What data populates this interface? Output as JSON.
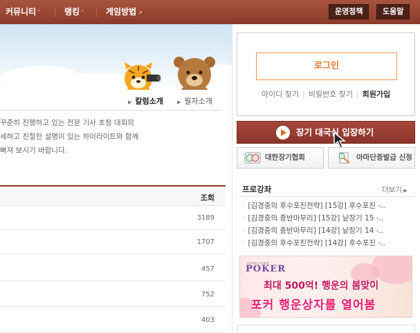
{
  "nav": {
    "items": [
      {
        "label": "커뮤니티",
        "caret": "˅"
      },
      {
        "label": "랭킹",
        "caret": "˅"
      },
      {
        "label": "게임방법",
        "caret": "↗"
      }
    ],
    "policy_button": "운영정책",
    "help_button": "도움말"
  },
  "subtabs": {
    "column_intro": "칼럼소개",
    "writer_intro": "필자소개"
  },
  "intro_lines": [
    "꾸준히 진행하고 있는 전문 기사 초청 대회의",
    "세하고 친절한 설명이 있는 하이라이트와 함께",
    "빠져 보시기 바랍니다."
  ],
  "table": {
    "views_header": "조회",
    "rows": [
      {
        "views": "3189"
      },
      {
        "views": "1707"
      },
      {
        "views": "457"
      },
      {
        "views": "752"
      },
      {
        "views": "403"
      }
    ]
  },
  "login": {
    "button": "로그인",
    "find_id": "아이디 찾기",
    "find_pw": "비밀번호 찾기",
    "signup": "회원가입"
  },
  "enter_button": "장기 대국실 입장하기",
  "partners": {
    "association": "대한장기협회",
    "amateur": "아마단증발급 신청"
  },
  "pro_lessons": {
    "title": "프로강좌",
    "more": "더보기",
    "items": [
      "[김경중의 후수포진전략] [15강] 후수포진 -..",
      "[김경중의 종반마무리] [15강] 낱장기 15 -..",
      "[김경중의 종반마무리] [14강] 낱장기 14 -..",
      "[김경중의 후수포진전략] [14강] 후수포진 -.."
    ]
  },
  "ad": {
    "brand_small": "HANGAME",
    "brand": "POKER",
    "line1": "최대 500억! 행운의 봄맞이",
    "line2": "포커 행운상자를 열어봄"
  },
  "colors": {
    "nav_bg": "#8c3a2b",
    "accent_orange": "#e07a30",
    "enter_bg": "#9b3e32",
    "ad_pink": "#e81f70"
  }
}
